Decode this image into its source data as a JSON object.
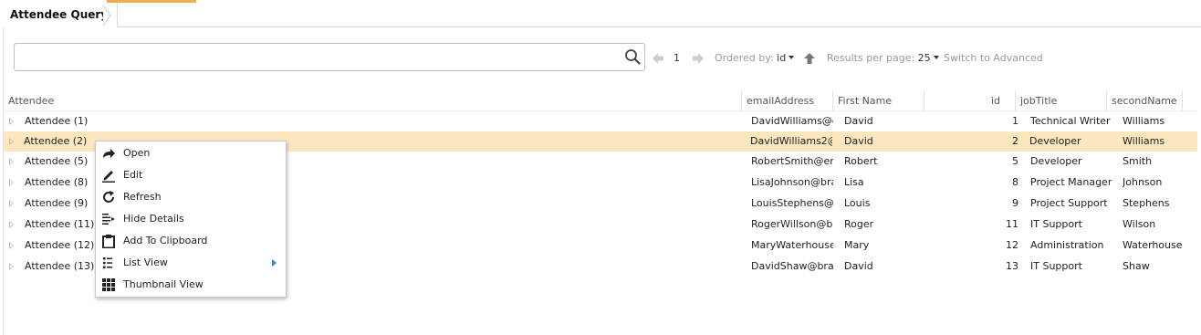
{
  "colors": {
    "accent": "#f0ad4e",
    "selected_row": "#fde7bf",
    "submenu_arrow": "#3b82c4"
  },
  "tab": {
    "title": "Attendee Query"
  },
  "search": {
    "value": "",
    "placeholder": "",
    "icon": "search-icon"
  },
  "pagination": {
    "page": "1",
    "prev_icon": "arrow-left-icon",
    "next_icon": "arrow-right-icon"
  },
  "ordering": {
    "label": "Ordered by:",
    "value": "id",
    "direction_icon": "arrow-up-icon"
  },
  "results": {
    "label": "Results per page:",
    "value": "25"
  },
  "switch_advanced": "Switch to Advanced",
  "columns": {
    "attendee": "Attendee",
    "email": "emailAddress",
    "first_name": "First Name",
    "id": "id",
    "job_title": "jobTitle",
    "second_name": "secondName"
  },
  "rows": [
    {
      "name": "Attendee (1)",
      "email": "DavidWilliams@g",
      "first": "David",
      "id": "1",
      "job": "Technical Writer",
      "second": "Williams"
    },
    {
      "name": "Attendee (2)",
      "email": "DavidWilliams2@",
      "first": "David",
      "id": "2",
      "job": "Developer",
      "second": "Williams",
      "selected": true
    },
    {
      "name": "Attendee (5)",
      "email": "RobertSmith@em",
      "first": "Robert",
      "id": "5",
      "job": "Developer",
      "second": "Smith"
    },
    {
      "name": "Attendee (8)",
      "email": "LisaJohnson@bra",
      "first": "Lisa",
      "id": "8",
      "job": "Project Manager",
      "second": "Johnson"
    },
    {
      "name": "Attendee (9)",
      "email": "LouisStephens@t",
      "first": "Louis",
      "id": "9",
      "job": "Project Support",
      "second": "Stephens"
    },
    {
      "name": "Attendee (11)",
      "email": "RogerWillson@br",
      "first": "Roger",
      "id": "11",
      "job": "IT Support",
      "second": "Wilson"
    },
    {
      "name": "Attendee (12)",
      "email": "MaryWaterhouse",
      "first": "Mary",
      "id": "12",
      "job": "Administration",
      "second": "Waterhouse"
    },
    {
      "name": "Attendee (13)",
      "email": "DavidShaw@brai",
      "first": "David",
      "id": "13",
      "job": "IT Support",
      "second": "Shaw"
    }
  ],
  "context_menu": {
    "items": [
      {
        "label": "Open",
        "icon": "open-arrow-icon"
      },
      {
        "label": "Edit",
        "icon": "pencil-icon"
      },
      {
        "label": "Refresh",
        "icon": "refresh-icon"
      },
      {
        "label": "Hide Details",
        "icon": "hide-details-icon"
      },
      {
        "label": "Add To Clipboard",
        "icon": "clipboard-icon"
      },
      {
        "label": "List View",
        "icon": "list-view-icon",
        "submenu": true
      },
      {
        "label": "Thumbnail View",
        "icon": "thumbnail-grid-icon"
      }
    ]
  }
}
